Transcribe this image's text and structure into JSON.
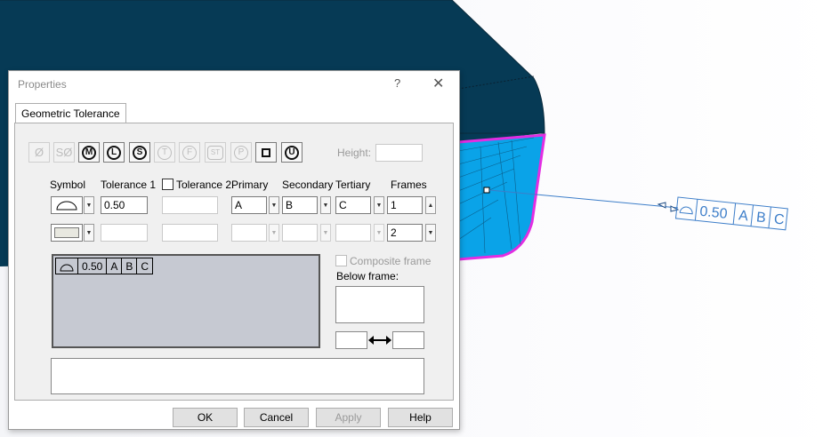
{
  "dialog": {
    "title": "Properties",
    "help_icon": "?",
    "close_icon": "✕",
    "tab_label": "Geometric Tolerance"
  },
  "modifiers": [
    {
      "icon": "diameter-icon",
      "glyph": "Ø",
      "active": false
    },
    {
      "icon": "spherical-diameter-icon",
      "glyph": "SØ",
      "active": false
    },
    {
      "icon": "mmc-icon",
      "glyph": "M",
      "active": true
    },
    {
      "icon": "lmc-icon",
      "glyph": "L",
      "active": true
    },
    {
      "icon": "rfs-icon",
      "glyph": "S",
      "active": true
    },
    {
      "icon": "tangent-plane-icon",
      "glyph": "T",
      "active": false
    },
    {
      "icon": "free-state-icon",
      "glyph": "F",
      "active": false
    },
    {
      "icon": "statistical-icon",
      "glyph": "ST",
      "active": false
    },
    {
      "icon": "projected-tolerance-icon",
      "glyph": "P",
      "active": false
    },
    {
      "icon": "square-icon",
      "glyph": "",
      "active": true
    },
    {
      "icon": "unequally-disposed-icon",
      "glyph": "U",
      "active": true
    }
  ],
  "height_label": "Height:",
  "columns": {
    "symbol": "Symbol",
    "tolerance1": "Tolerance 1",
    "tolerance2": "Tolerance 2",
    "primary": "Primary",
    "secondary": "Secondary",
    "tertiary": "Tertiary",
    "frames": "Frames"
  },
  "row1": {
    "symbol_icon": "profile-of-surface-icon",
    "tolerance1": "0.50",
    "tolerance2": "",
    "primary": "A",
    "secondary": "B",
    "tertiary": "C",
    "frames": "1"
  },
  "row2": {
    "tolerance1": "",
    "tolerance2": "",
    "primary": "",
    "secondary": "",
    "tertiary": "",
    "frames": "2"
  },
  "preview": {
    "symbol_icon": "profile-of-surface-icon",
    "cells": [
      "0.50",
      "A",
      "B",
      "C"
    ]
  },
  "composite_frame_label": "Composite frame",
  "below_frame_label": "Below frame:",
  "buttons": {
    "ok": "OK",
    "cancel": "Cancel",
    "apply": "Apply",
    "help": "Help"
  },
  "viewport_annotation": {
    "symbol_icon": "profile-of-surface-icon",
    "cells": [
      "0.50",
      "A",
      "B",
      "C"
    ]
  },
  "colors": {
    "model_dark": "#063a55",
    "model_blue": "#0aa3e8",
    "model_highlight": "#e22de2",
    "annotation": "#3d7ec9",
    "preview_bg": "#c6c9d2"
  }
}
